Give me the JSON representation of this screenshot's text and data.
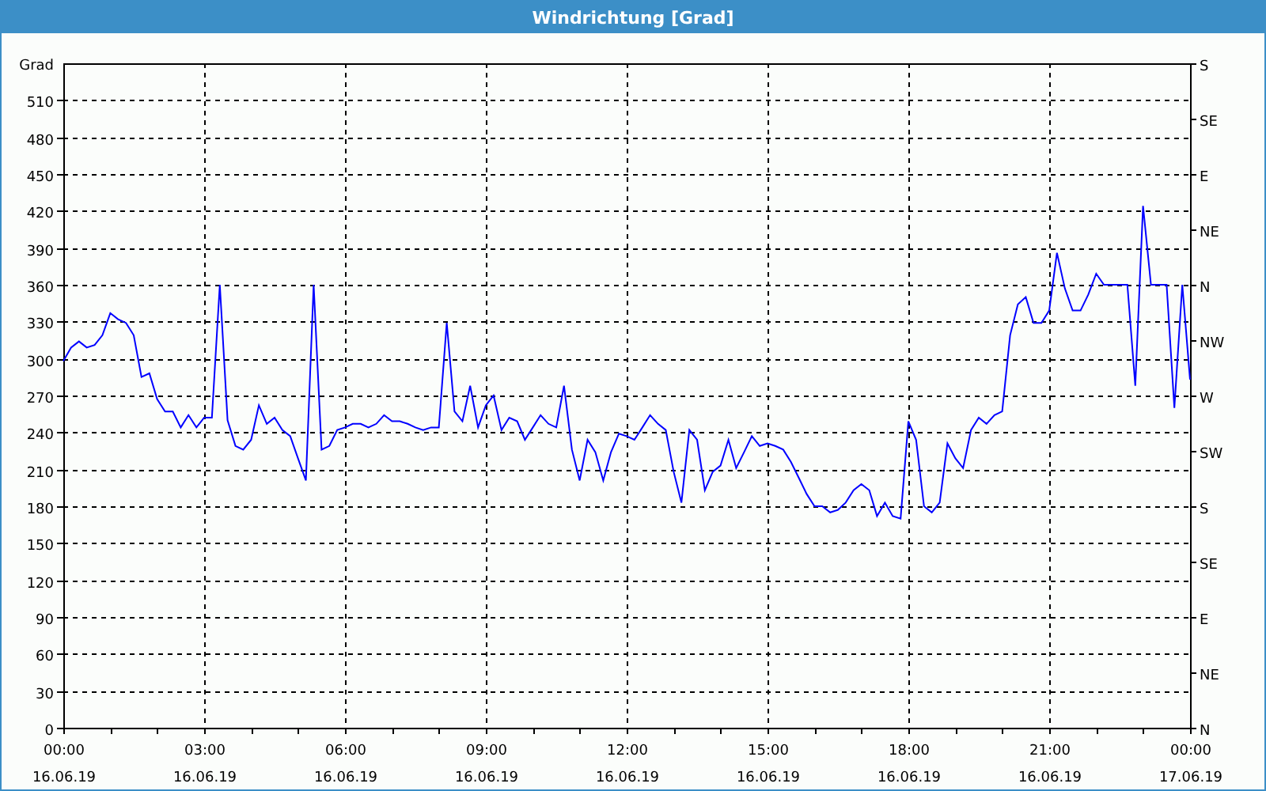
{
  "chart_data": {
    "type": "line",
    "title": "Windrichtung [Grad]",
    "ylabel": "Grad",
    "categories": [
      "00:00\n16.06.19",
      null,
      null,
      null,
      null,
      null,
      null,
      null,
      null,
      null,
      null,
      null,
      null,
      null,
      null,
      null,
      null,
      null,
      "03:00\n16.06.19",
      null,
      null,
      null,
      null,
      null,
      null,
      null,
      null,
      null,
      null,
      null,
      null,
      null,
      null,
      null,
      null,
      null,
      "06:00\n16.06.19",
      null,
      null,
      null,
      null,
      null,
      null,
      null,
      null,
      null,
      null,
      null,
      null,
      null,
      null,
      null,
      null,
      null,
      "09:00\n16.06.19",
      null,
      null,
      null,
      null,
      null,
      null,
      null,
      null,
      null,
      null,
      null,
      null,
      null,
      null,
      null,
      null,
      null,
      "12:00\n16.06.19",
      null,
      null,
      null,
      null,
      null,
      null,
      null,
      null,
      null,
      null,
      null,
      null,
      null,
      null,
      null,
      null,
      null,
      "15:00\n16.06.19",
      null,
      null,
      null,
      null,
      null,
      null,
      null,
      null,
      null,
      null,
      null,
      null,
      null,
      null,
      null,
      null,
      null,
      "18:00\n16.06.19",
      null,
      null,
      null,
      null,
      null,
      null,
      null,
      null,
      null,
      null,
      null,
      null,
      null,
      null,
      null,
      null,
      null,
      "21:00\n16.06.19",
      null,
      null,
      null,
      null,
      null,
      null,
      null,
      null,
      null,
      null,
      null,
      null,
      null,
      null,
      null,
      null,
      null,
      "00:00\n17.06.19"
    ],
    "series": [
      {
        "color": "#0000ff",
        "values": [
          298,
          309,
          314,
          309,
          311,
          319,
          337,
          332,
          329,
          319,
          285,
          288,
          267,
          257,
          257,
          244,
          254,
          244,
          252,
          252,
          360,
          250,
          229,
          226,
          234,
          262,
          247,
          252,
          242,
          237,
          219,
          201,
          360,
          226,
          229,
          242,
          244,
          247,
          247,
          244,
          247,
          254,
          249,
          249,
          247,
          244,
          242,
          244,
          244,
          329,
          257,
          249,
          278,
          244,
          262,
          270,
          242,
          252,
          249,
          234,
          244,
          254,
          247,
          244,
          278,
          226,
          201,
          234,
          224,
          201,
          224,
          239,
          237,
          234,
          244,
          254,
          247,
          242,
          208,
          183,
          242,
          234,
          193,
          208,
          213,
          234,
          211,
          224,
          237,
          229,
          231,
          229,
          226,
          216,
          203,
          190,
          180,
          180,
          175,
          177,
          183,
          193,
          198,
          193,
          172,
          183,
          172,
          170,
          249,
          234,
          180,
          175,
          183,
          231,
          219,
          211,
          242,
          252,
          247,
          254,
          257,
          319,
          344,
          350,
          329,
          329,
          339,
          386,
          357,
          339,
          339,
          352,
          369,
          360,
          360,
          360,
          360,
          278,
          424,
          360,
          360,
          360,
          260,
          360,
          283
        ]
      }
    ],
    "grid": true,
    "ylim": [
      0,
      540
    ],
    "yticks": [
      0,
      30,
      60,
      90,
      120,
      150,
      180,
      210,
      240,
      270,
      300,
      330,
      360,
      390,
      420,
      450,
      480,
      510
    ]
  },
  "compass_axis": {
    "labels": [
      "S",
      "SE",
      "E",
      "NE",
      "N",
      "NW",
      "W",
      "SW",
      "S",
      "SE",
      "E",
      "NE",
      "N"
    ]
  }
}
